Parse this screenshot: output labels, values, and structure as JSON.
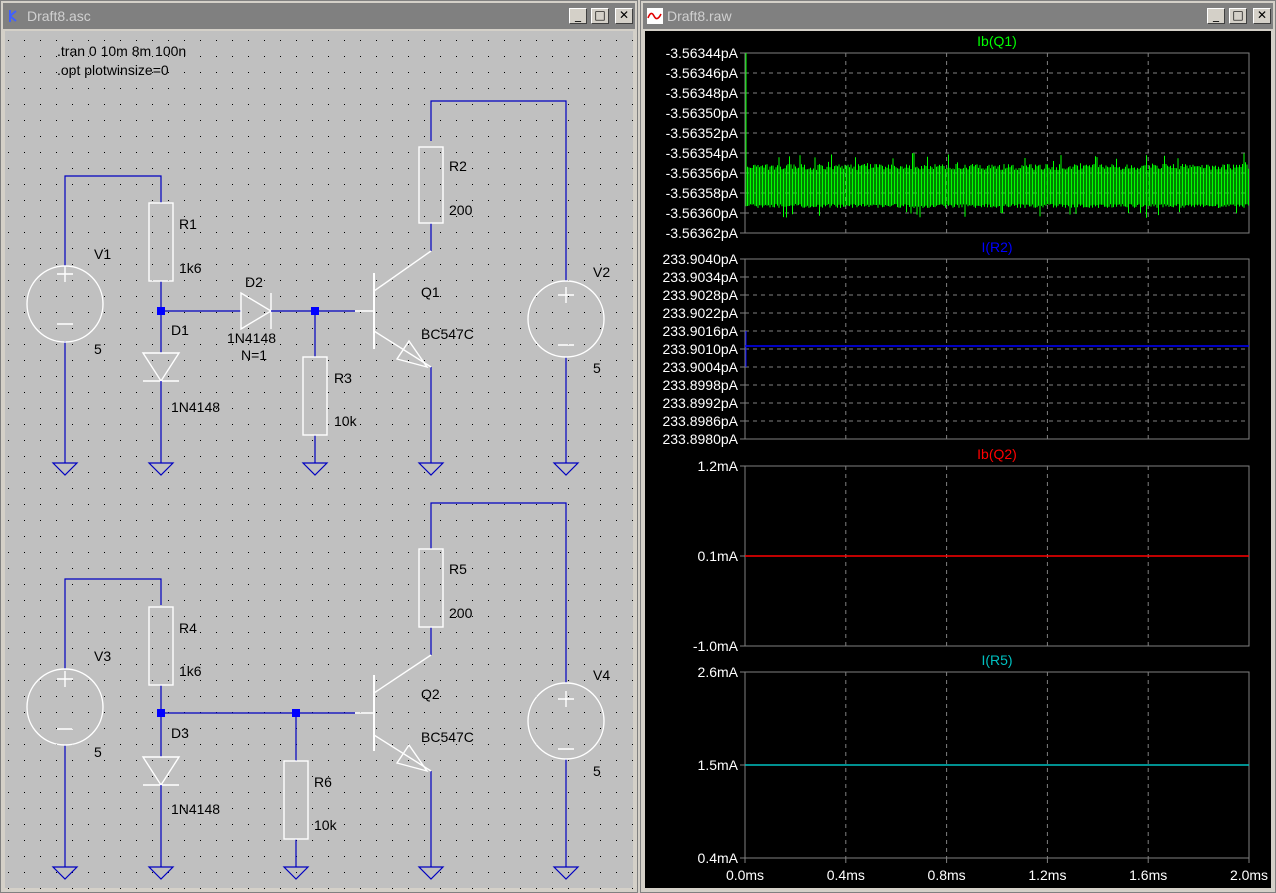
{
  "schematic_window": {
    "title": "Draft8.asc",
    "directives": [
      ".tran 0 10m 8m 100n",
      ".opt plotwinsize=0"
    ],
    "labels": {
      "v1": "V1",
      "v1_val": "5",
      "r1": "R1",
      "r1_val": "1k6",
      "d1": "D1",
      "d1_model": "1N4148",
      "d2": "D2",
      "d2_model": "1N4148",
      "d2_param": "N=1",
      "r3": "R3",
      "r3_val": "10k",
      "r2": "R2",
      "r2_val": "200",
      "q1": "Q1",
      "q1_model": "BC547C",
      "v2": "V2",
      "v2_val": "5",
      "v3": "V3",
      "v3_val": "5",
      "r4": "R4",
      "r4_val": "1k6",
      "d3": "D3",
      "d3_model": "1N4148",
      "r6": "R6",
      "r6_val": "10k",
      "r5": "R5",
      "r5_val": "200",
      "q2": "Q2",
      "q2_model": "BC547C",
      "v4": "V4",
      "v4_val": "5"
    }
  },
  "waveform_window": {
    "title": "Draft8.raw",
    "colors": {
      "ibq1": "#00ff00",
      "ir2": "#0000ff",
      "ibq2": "#ff0000",
      "ir5": "#00c0c0"
    },
    "pane1": {
      "title": "Ib(Q1)",
      "ticks": [
        "-3.56344pA",
        "-3.56346pA",
        "-3.56348pA",
        "-3.56350pA",
        "-3.56352pA",
        "-3.56354pA",
        "-3.56356pA",
        "-3.56358pA",
        "-3.56360pA",
        "-3.56362pA"
      ]
    },
    "pane2": {
      "title": "I(R2)",
      "ticks": [
        "233.9040pA",
        "233.9034pA",
        "233.9028pA",
        "233.9022pA",
        "233.9016pA",
        "233.9010pA",
        "233.9004pA",
        "233.8998pA",
        "233.8992pA",
        "233.8986pA",
        "233.8980pA"
      ]
    },
    "pane3": {
      "title": "Ib(Q2)",
      "ticks": [
        "1.2mA",
        "0.1mA",
        "-1.0mA"
      ]
    },
    "pane4": {
      "title": "I(R5)",
      "ticks": [
        "2.6mA",
        "1.5mA",
        "0.4mA"
      ]
    },
    "xticks": [
      "0.0ms",
      "0.4ms",
      "0.8ms",
      "1.2ms",
      "1.6ms",
      "2.0ms"
    ]
  },
  "chart_data": [
    {
      "type": "line",
      "title": "Ib(Q1)",
      "x": [
        0,
        2
      ],
      "series": [
        {
          "name": "Ib(Q1)",
          "values": [
            -3.56357,
            -3.56357
          ]
        }
      ],
      "ylim": [
        -3.56362,
        -3.56344
      ]
    },
    {
      "type": "line",
      "title": "I(R2)",
      "x": [
        0,
        2
      ],
      "series": [
        {
          "name": "I(R2)",
          "values": [
            233.9011,
            233.9011
          ]
        }
      ],
      "ylim": [
        233.898,
        233.904
      ]
    },
    {
      "type": "line",
      "title": "Ib(Q2)",
      "x": [
        0,
        2
      ],
      "series": [
        {
          "name": "Ib(Q2)",
          "values": [
            0.1,
            0.1
          ]
        }
      ],
      "ylim": [
        -1.0,
        1.2
      ]
    },
    {
      "type": "line",
      "title": "I(R5)",
      "x": [
        0,
        2
      ],
      "series": [
        {
          "name": "I(R5)",
          "values": [
            1.5,
            1.5
          ]
        }
      ],
      "ylim": [
        0.4,
        2.6
      ]
    }
  ]
}
